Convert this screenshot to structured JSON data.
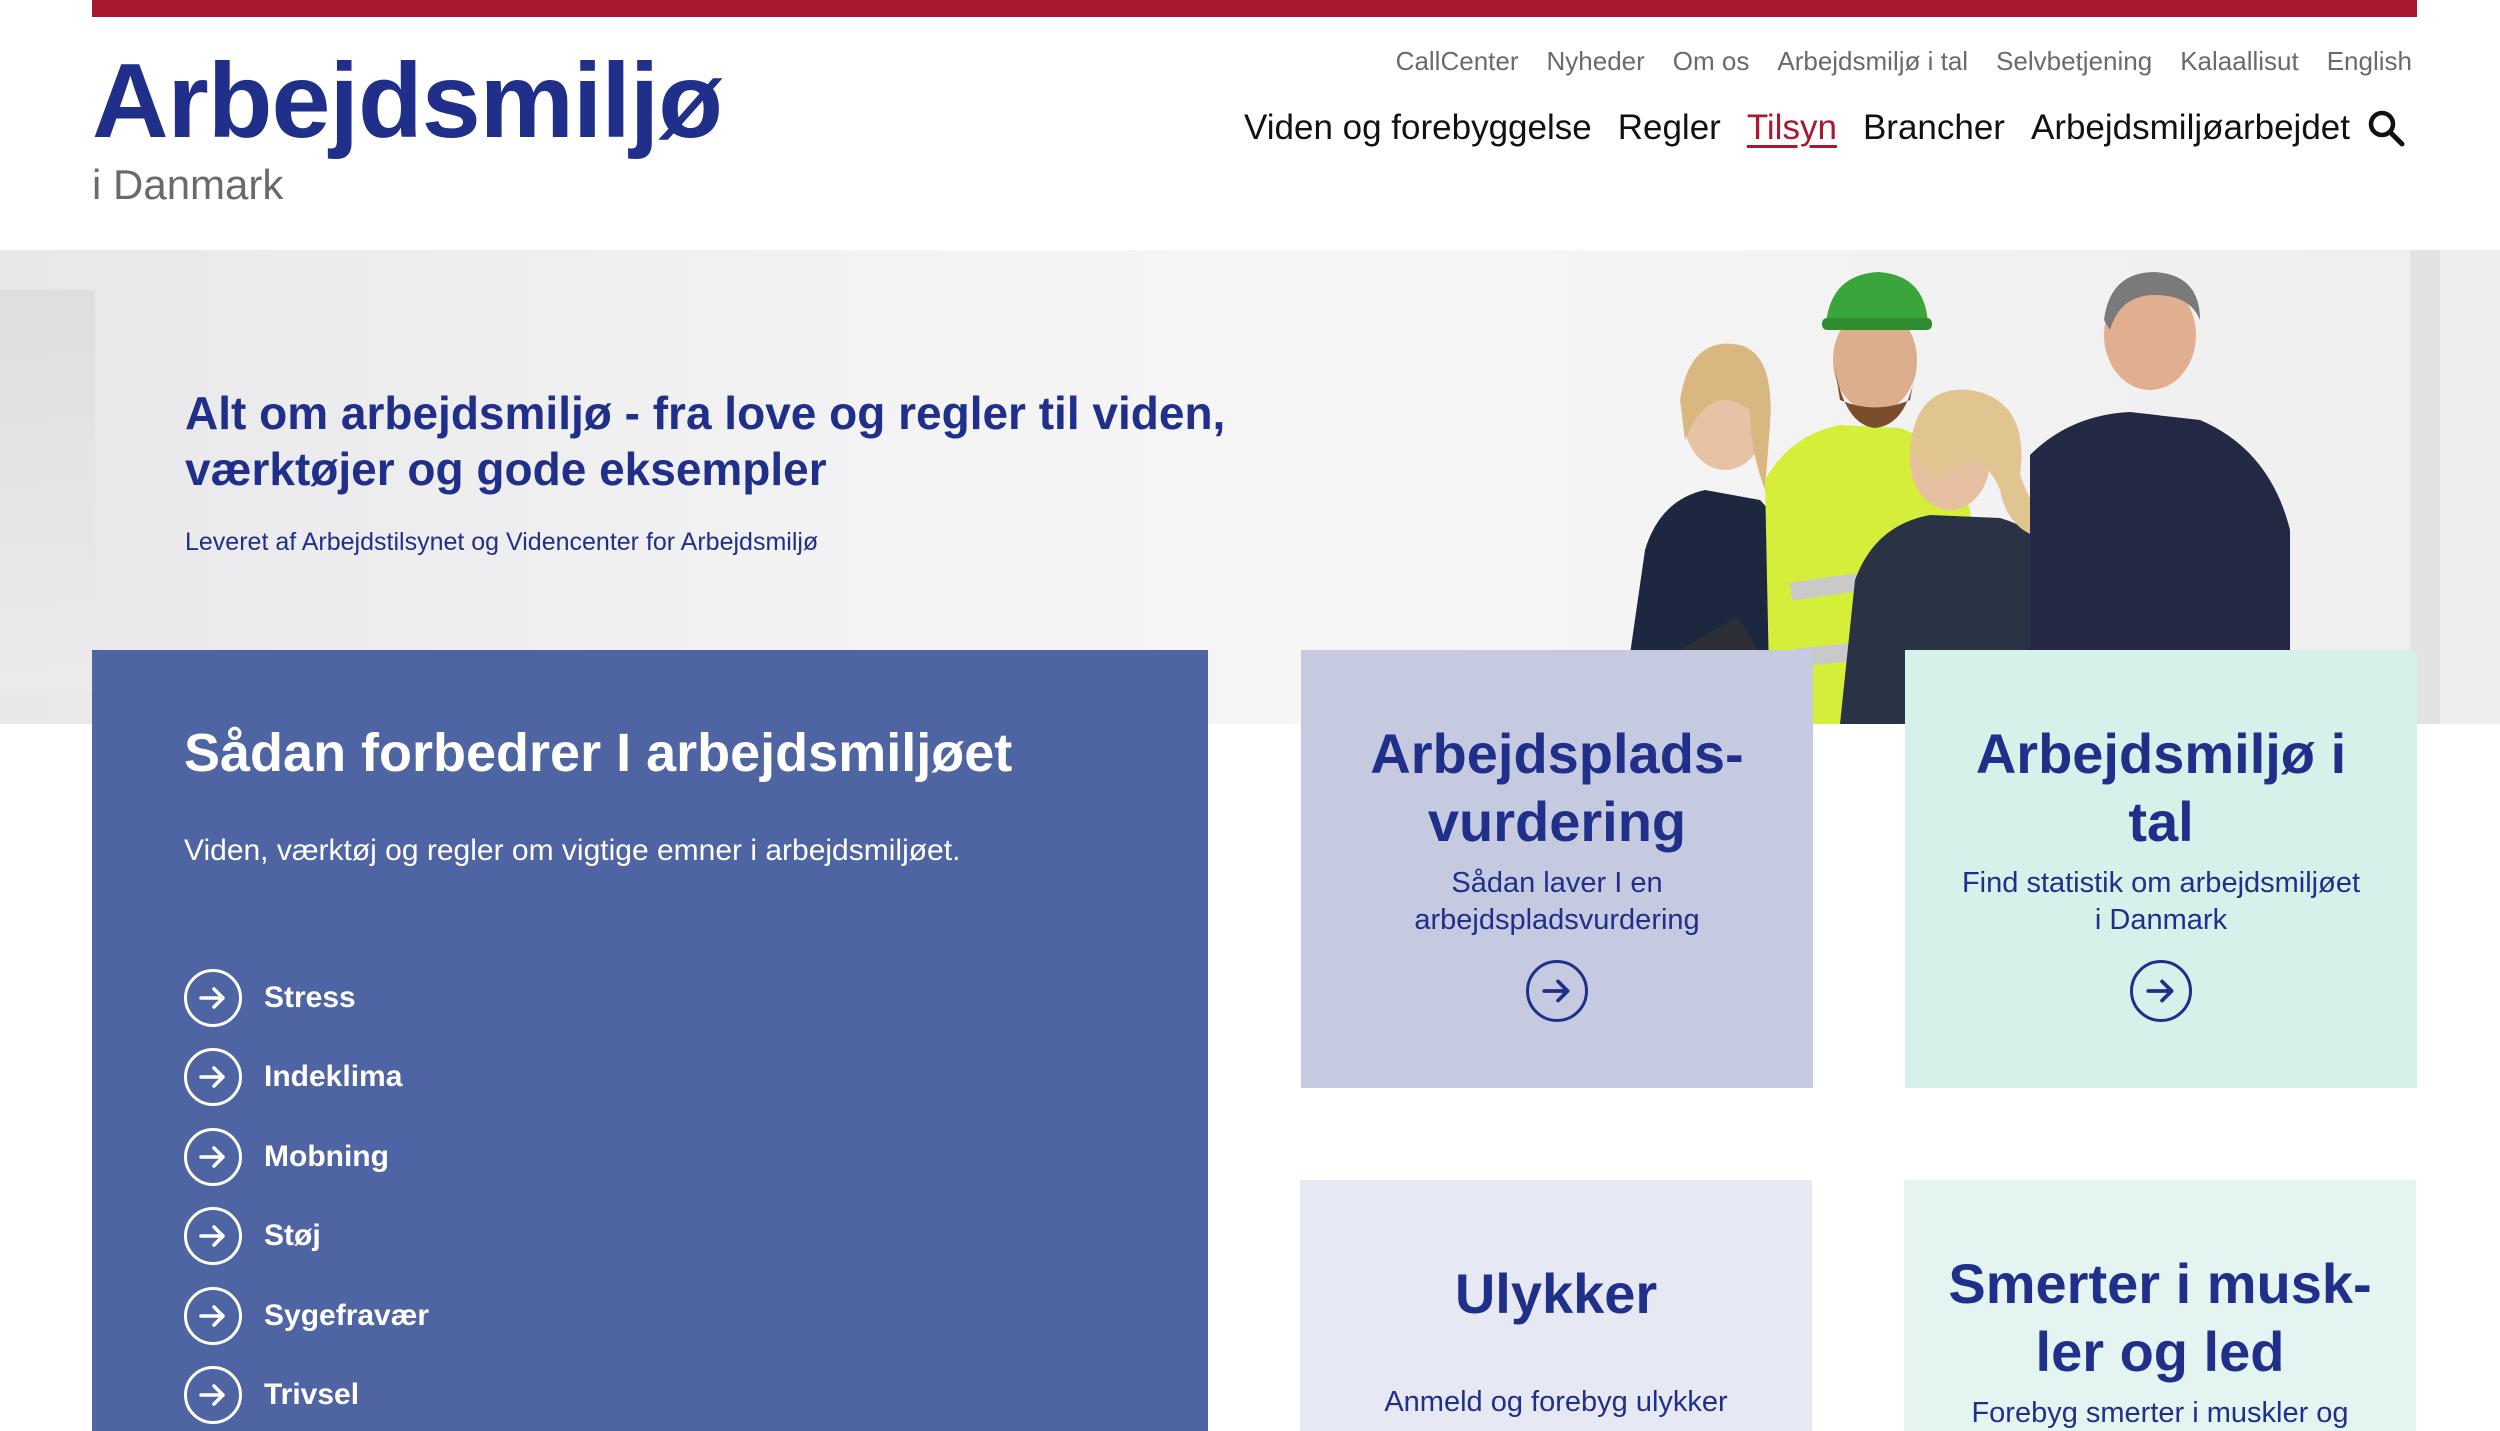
{
  "header": {
    "logo_title": "Arbejdsmiljø",
    "logo_sub": "i Danmark",
    "util_nav": [
      "CallCenter",
      "Nyheder",
      "Om os",
      "Arbejdsmiljø i tal",
      "Selvbetjening",
      "Kalaallisut",
      "English"
    ],
    "main_nav": [
      "Viden og forebyggelse",
      "Regler",
      "Tilsyn",
      "Brancher",
      "Arbejdsmiljøarbejdet"
    ],
    "active_nav": "Tilsyn",
    "search_icon": "search-icon"
  },
  "hero": {
    "title": "Alt om arbejdsmiljø - fra love og regler til viden, værktøjer og gode eksempler",
    "subtitle": "Leveret af Arbejdstilsynet og Videncenter for Arbejdsmiljø"
  },
  "main_card": {
    "title": "Sådan forbedrer I arbejdsmiljøet",
    "description": "Viden, værktøj og regler om vigtige emner i arbejdsmiljøet.",
    "topics": [
      "Stress",
      "Indeklima",
      "Mobning",
      "Støj",
      "Sygefravær",
      "Trivsel"
    ]
  },
  "cards": [
    {
      "title_line1": "Arbejdsplads-",
      "title_line2": "vurdering",
      "desc_line1": "Sådan laver I en",
      "desc_line2": "arbejdspladsvurdering",
      "color": "#c5cae0"
    },
    {
      "title_line1": "Arbejdsmiljø i",
      "title_line2": "tal",
      "desc_line1": "Find statistik om arbejdsmiljøet",
      "desc_line2": "i Danmark",
      "color": "#d6f0ea"
    },
    {
      "title_line1": "Ulykker",
      "title_line2": "",
      "desc_line1": "Anmeld og forebyg ulykker",
      "desc_line2": "",
      "color": "#e6e9f3"
    },
    {
      "title_line1": "Smerter i musk-",
      "title_line2": "ler og led",
      "desc_line1": "Forebyg smerter i muskler og",
      "desc_line2": "",
      "color": "#e4f5f1"
    }
  ],
  "colors": {
    "brand_red": "#a8182e",
    "brand_blue": "#1f2f8a",
    "card_blue": "#4f64a2"
  }
}
